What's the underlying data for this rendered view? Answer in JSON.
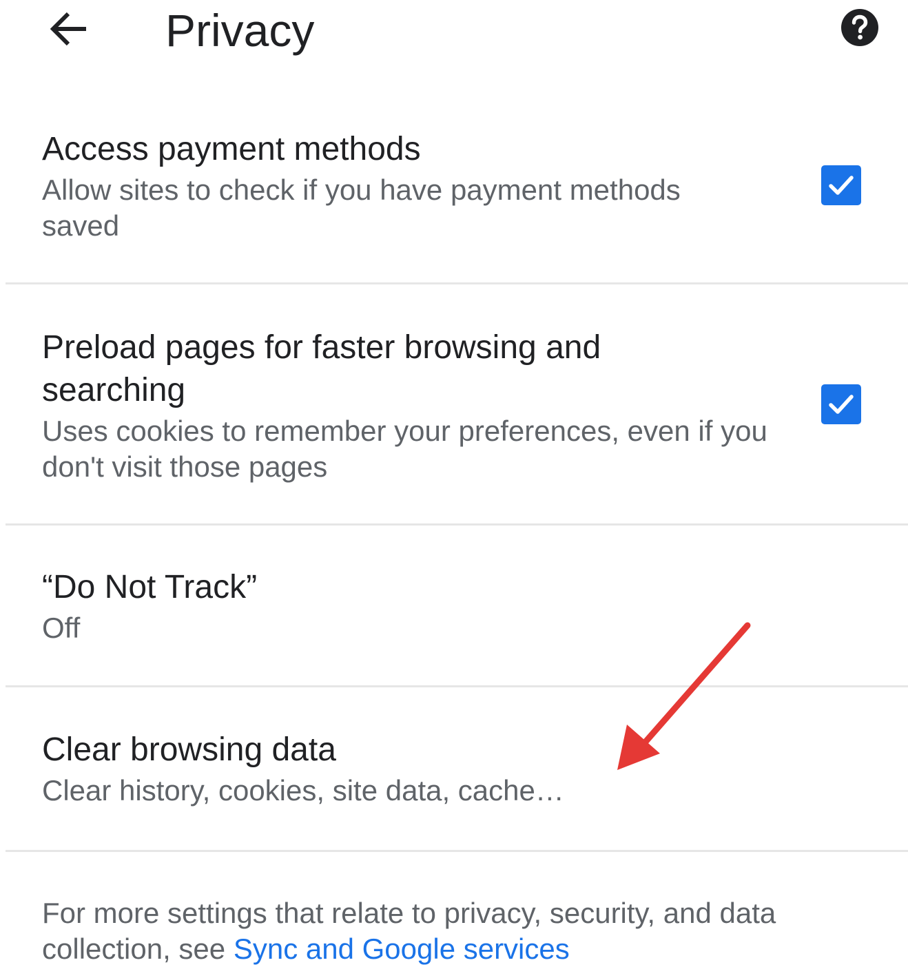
{
  "header": {
    "title": "Privacy",
    "back_icon": "arrow-back-icon",
    "help_icon": "help-circle-icon"
  },
  "settings": [
    {
      "title": "Access payment methods",
      "subtitle": "Allow sites to check if you have payment methods saved",
      "checked": true
    },
    {
      "title": "Preload pages for faster browsing and searching",
      "subtitle": "Uses cookies to remember your preferences, even if you don't visit those pages",
      "checked": true
    },
    {
      "title": "“Do Not Track”",
      "subtitle": "Off"
    },
    {
      "title": "Clear browsing data",
      "subtitle": "Clear history, cookies, site data, cache…"
    }
  ],
  "footer": {
    "text": "For more settings that relate to privacy, security, and data collection, see ",
    "link_label": "Sync and Google services"
  },
  "colors": {
    "accent": "#1a73e8",
    "annotation": "#e53935"
  }
}
